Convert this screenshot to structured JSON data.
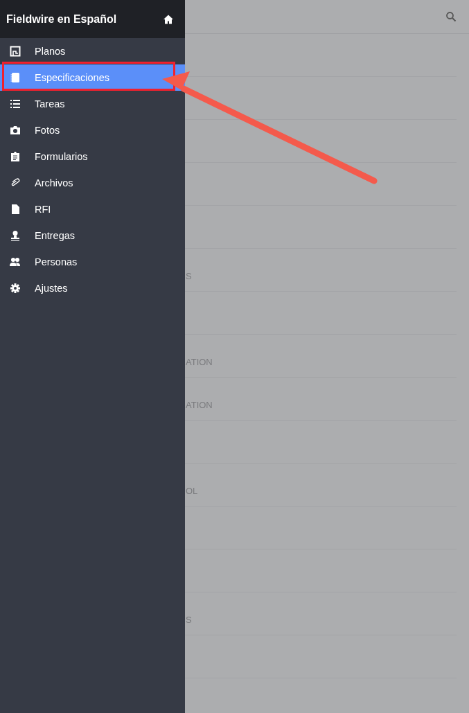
{
  "drawer": {
    "title": "Fieldwire en Español",
    "items": [
      {
        "label": "Planos",
        "kind": "plans",
        "selected": false
      },
      {
        "label": "Especificaciones",
        "kind": "specs",
        "selected": true
      },
      {
        "label": "Tareas",
        "kind": "list",
        "selected": false
      },
      {
        "label": "Fotos",
        "kind": "camera",
        "selected": false
      },
      {
        "label": "Formularios",
        "kind": "clipboard",
        "selected": false
      },
      {
        "label": "Archivos",
        "kind": "clip",
        "selected": false
      },
      {
        "label": "RFI",
        "kind": "doc",
        "selected": false
      },
      {
        "label": "Entregas",
        "kind": "stamp",
        "selected": false
      },
      {
        "label": "Personas",
        "kind": "people",
        "selected": false
      },
      {
        "label": "Ajustes",
        "kind": "gear",
        "selected": false
      }
    ]
  },
  "list": {
    "rows": [
      "",
      "",
      "",
      "",
      "",
      "S",
      "",
      "ATION",
      "ATION",
      "",
      "OL",
      "",
      "",
      "S",
      "",
      ""
    ]
  }
}
